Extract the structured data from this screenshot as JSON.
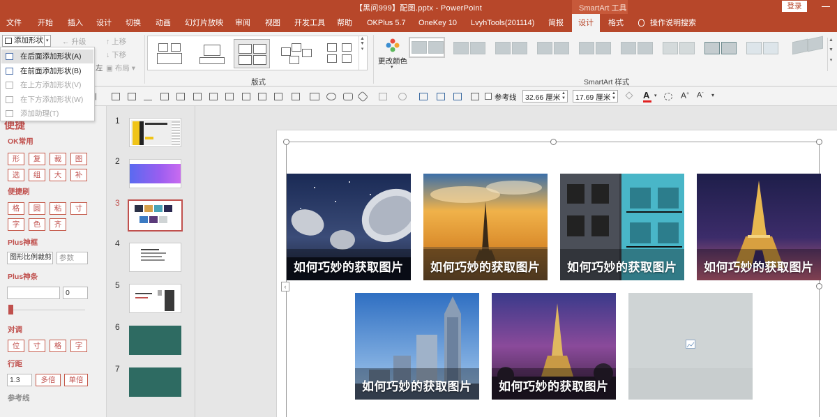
{
  "window": {
    "title": "【黑问999】配图.pptx - PowerPoint",
    "context_tab_header": "SmartArt 工具",
    "login_button": "登录"
  },
  "ribbon_tabs": [
    {
      "label": "文件",
      "active": false
    },
    {
      "label": "开始",
      "active": false
    },
    {
      "label": "插入",
      "active": false
    },
    {
      "label": "设计",
      "active": false
    },
    {
      "label": "切换",
      "active": false
    },
    {
      "label": "动画",
      "active": false
    },
    {
      "label": "幻灯片放映",
      "active": false
    },
    {
      "label": "审阅",
      "active": false
    },
    {
      "label": "视图",
      "active": false
    },
    {
      "label": "开发工具",
      "active": false
    },
    {
      "label": "帮助",
      "active": false
    },
    {
      "label": "OKPlus 5.7",
      "active": false
    },
    {
      "label": "OneKey 10",
      "active": false
    },
    {
      "label": "LvyhTools(201114)",
      "active": false
    },
    {
      "label": "简报",
      "active": false
    },
    {
      "label": "设计",
      "active": true
    },
    {
      "label": "格式",
      "active": false
    }
  ],
  "tell_me": "操作说明搜索",
  "create_graphic": {
    "add_shape": "添加形状",
    "promote": "升级",
    "demote": "降级",
    "move_up": "上移",
    "move_down": "下移",
    "layout": "布局",
    "left_label": "左"
  },
  "add_shape_menu": [
    {
      "label": "在后面添加形状(A)",
      "enabled": true,
      "highlighted": true
    },
    {
      "label": "在前面添加形状(B)",
      "enabled": true,
      "highlighted": false
    },
    {
      "label": "在上方添加形状(V)",
      "enabled": false,
      "highlighted": false
    },
    {
      "label": "在下方添加形状(W)",
      "enabled": false,
      "highlighted": false
    },
    {
      "label": "添加助理(T)",
      "enabled": false,
      "highlighted": false
    }
  ],
  "groups": {
    "layouts": "版式",
    "change_colors": "更改颜色",
    "smartart_styles": "SmartArt 样式"
  },
  "format_bar": {
    "gridlines_label": "参考线",
    "width_value": "32.66 厘米",
    "height_value": "17.69 厘米",
    "font_color_accent": "#e02020"
  },
  "left_panel": {
    "header": "便捷",
    "ok_section": "OK常用",
    "ok_buttons": [
      "形",
      "复",
      "裁",
      "图",
      "选",
      "组",
      "大",
      "补"
    ],
    "brush_section": "便捷刷",
    "brush_buttons": [
      "格",
      "圆",
      "粘",
      "寸",
      "字",
      "色",
      "齐"
    ],
    "plus_frame_section": "Plus神框",
    "crop_label": "图形比例裁剪",
    "param_placeholder": "参数",
    "plus_bar_section": "Plus神条",
    "bar_value": "0",
    "align_section": "对调",
    "align_buttons": [
      "位",
      "寸",
      "格",
      "字"
    ],
    "spacing_section": "行距",
    "spacing_value": "1.3",
    "multi_label": "多倍",
    "single_label": "单倍",
    "guides_section": "参考线"
  },
  "slides": [
    {
      "number": "1",
      "active": false
    },
    {
      "number": "2",
      "active": false
    },
    {
      "number": "3",
      "active": true
    },
    {
      "number": "4",
      "active": false
    },
    {
      "number": "5",
      "active": false
    },
    {
      "number": "6",
      "active": false
    },
    {
      "number": "7",
      "active": false
    }
  ],
  "smartart_pictures": [
    {
      "caption": "如何巧妙的获取图片",
      "image": "satellite-dishes-night-sky"
    },
    {
      "caption": "如何巧妙的获取图片",
      "image": "eiffel-tower-sunset-city"
    },
    {
      "caption": "如何巧妙的获取图片",
      "image": "blue-fire-escape-building"
    },
    {
      "caption": "如何巧妙的获取图片",
      "image": "eiffel-tower-lit-night"
    },
    {
      "caption": "如何巧妙的获取图片",
      "image": "skyscrapers-blue-sky"
    },
    {
      "caption": "如何巧妙的获取图片",
      "image": "eiffel-tower-purple-dusk"
    },
    {
      "caption": "",
      "image": "empty-picture-placeholder"
    }
  ],
  "colors": {
    "accent": "#b7472a",
    "addin_red": "#c0504d",
    "thumbnail_teal": "#2e6b62"
  }
}
